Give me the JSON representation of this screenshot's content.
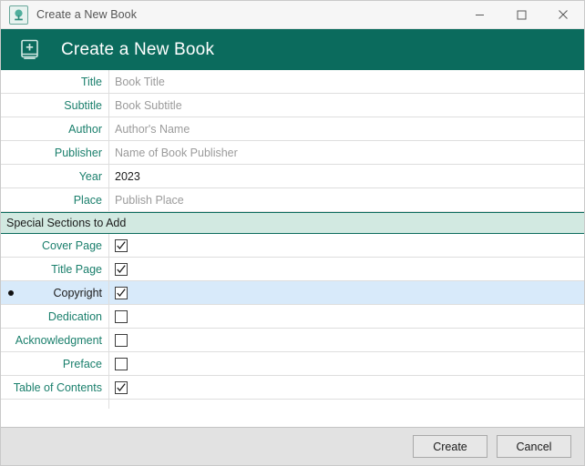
{
  "window": {
    "title": "Create a New Book",
    "app_icon": "tree-book-icon",
    "controls": [
      {
        "name": "minimize",
        "glyph": "minimize-icon"
      },
      {
        "name": "maximize",
        "glyph": "maximize-icon"
      },
      {
        "name": "close",
        "glyph": "close-icon"
      }
    ]
  },
  "header": {
    "title": "Create a New Book",
    "icon": "book-plus-icon",
    "bg_color": "#0b6b5d",
    "text_color": "#ffffff"
  },
  "form": {
    "fields": [
      {
        "label": "Title",
        "placeholder": "Book Title",
        "value": ""
      },
      {
        "label": "Subtitle",
        "placeholder": "Book Subtitle",
        "value": ""
      },
      {
        "label": "Author",
        "placeholder": "Author's Name",
        "value": ""
      },
      {
        "label": "Publisher",
        "placeholder": "Name of Book Publisher",
        "value": ""
      },
      {
        "label": "Year",
        "placeholder": "",
        "value": "2023"
      },
      {
        "label": "Place",
        "placeholder": "Publish Place",
        "value": ""
      }
    ]
  },
  "section": {
    "title": "Special Sections to Add",
    "bg_color": "#d2e9e1",
    "border_color": "#0b6b5d"
  },
  "sections_list": {
    "selected_row_color": "#d8eafa",
    "items": [
      {
        "label": "Cover Page",
        "checked": true,
        "selected": false
      },
      {
        "label": "Title Page",
        "checked": true,
        "selected": false
      },
      {
        "label": "Copyright",
        "checked": true,
        "selected": true
      },
      {
        "label": "Dedication",
        "checked": false,
        "selected": false
      },
      {
        "label": "Acknowledgment",
        "checked": false,
        "selected": false
      },
      {
        "label": "Preface",
        "checked": false,
        "selected": false
      },
      {
        "label": "Table of Contents",
        "checked": true,
        "selected": false
      }
    ]
  },
  "footer": {
    "create_label": "Create",
    "cancel_label": "Cancel"
  },
  "colors": {
    "accent_teal": "#0b6b5d",
    "label_teal": "#1a7f6c",
    "placeholder_gray": "#9b9b9b",
    "footer_gray": "#e2e2e2"
  }
}
